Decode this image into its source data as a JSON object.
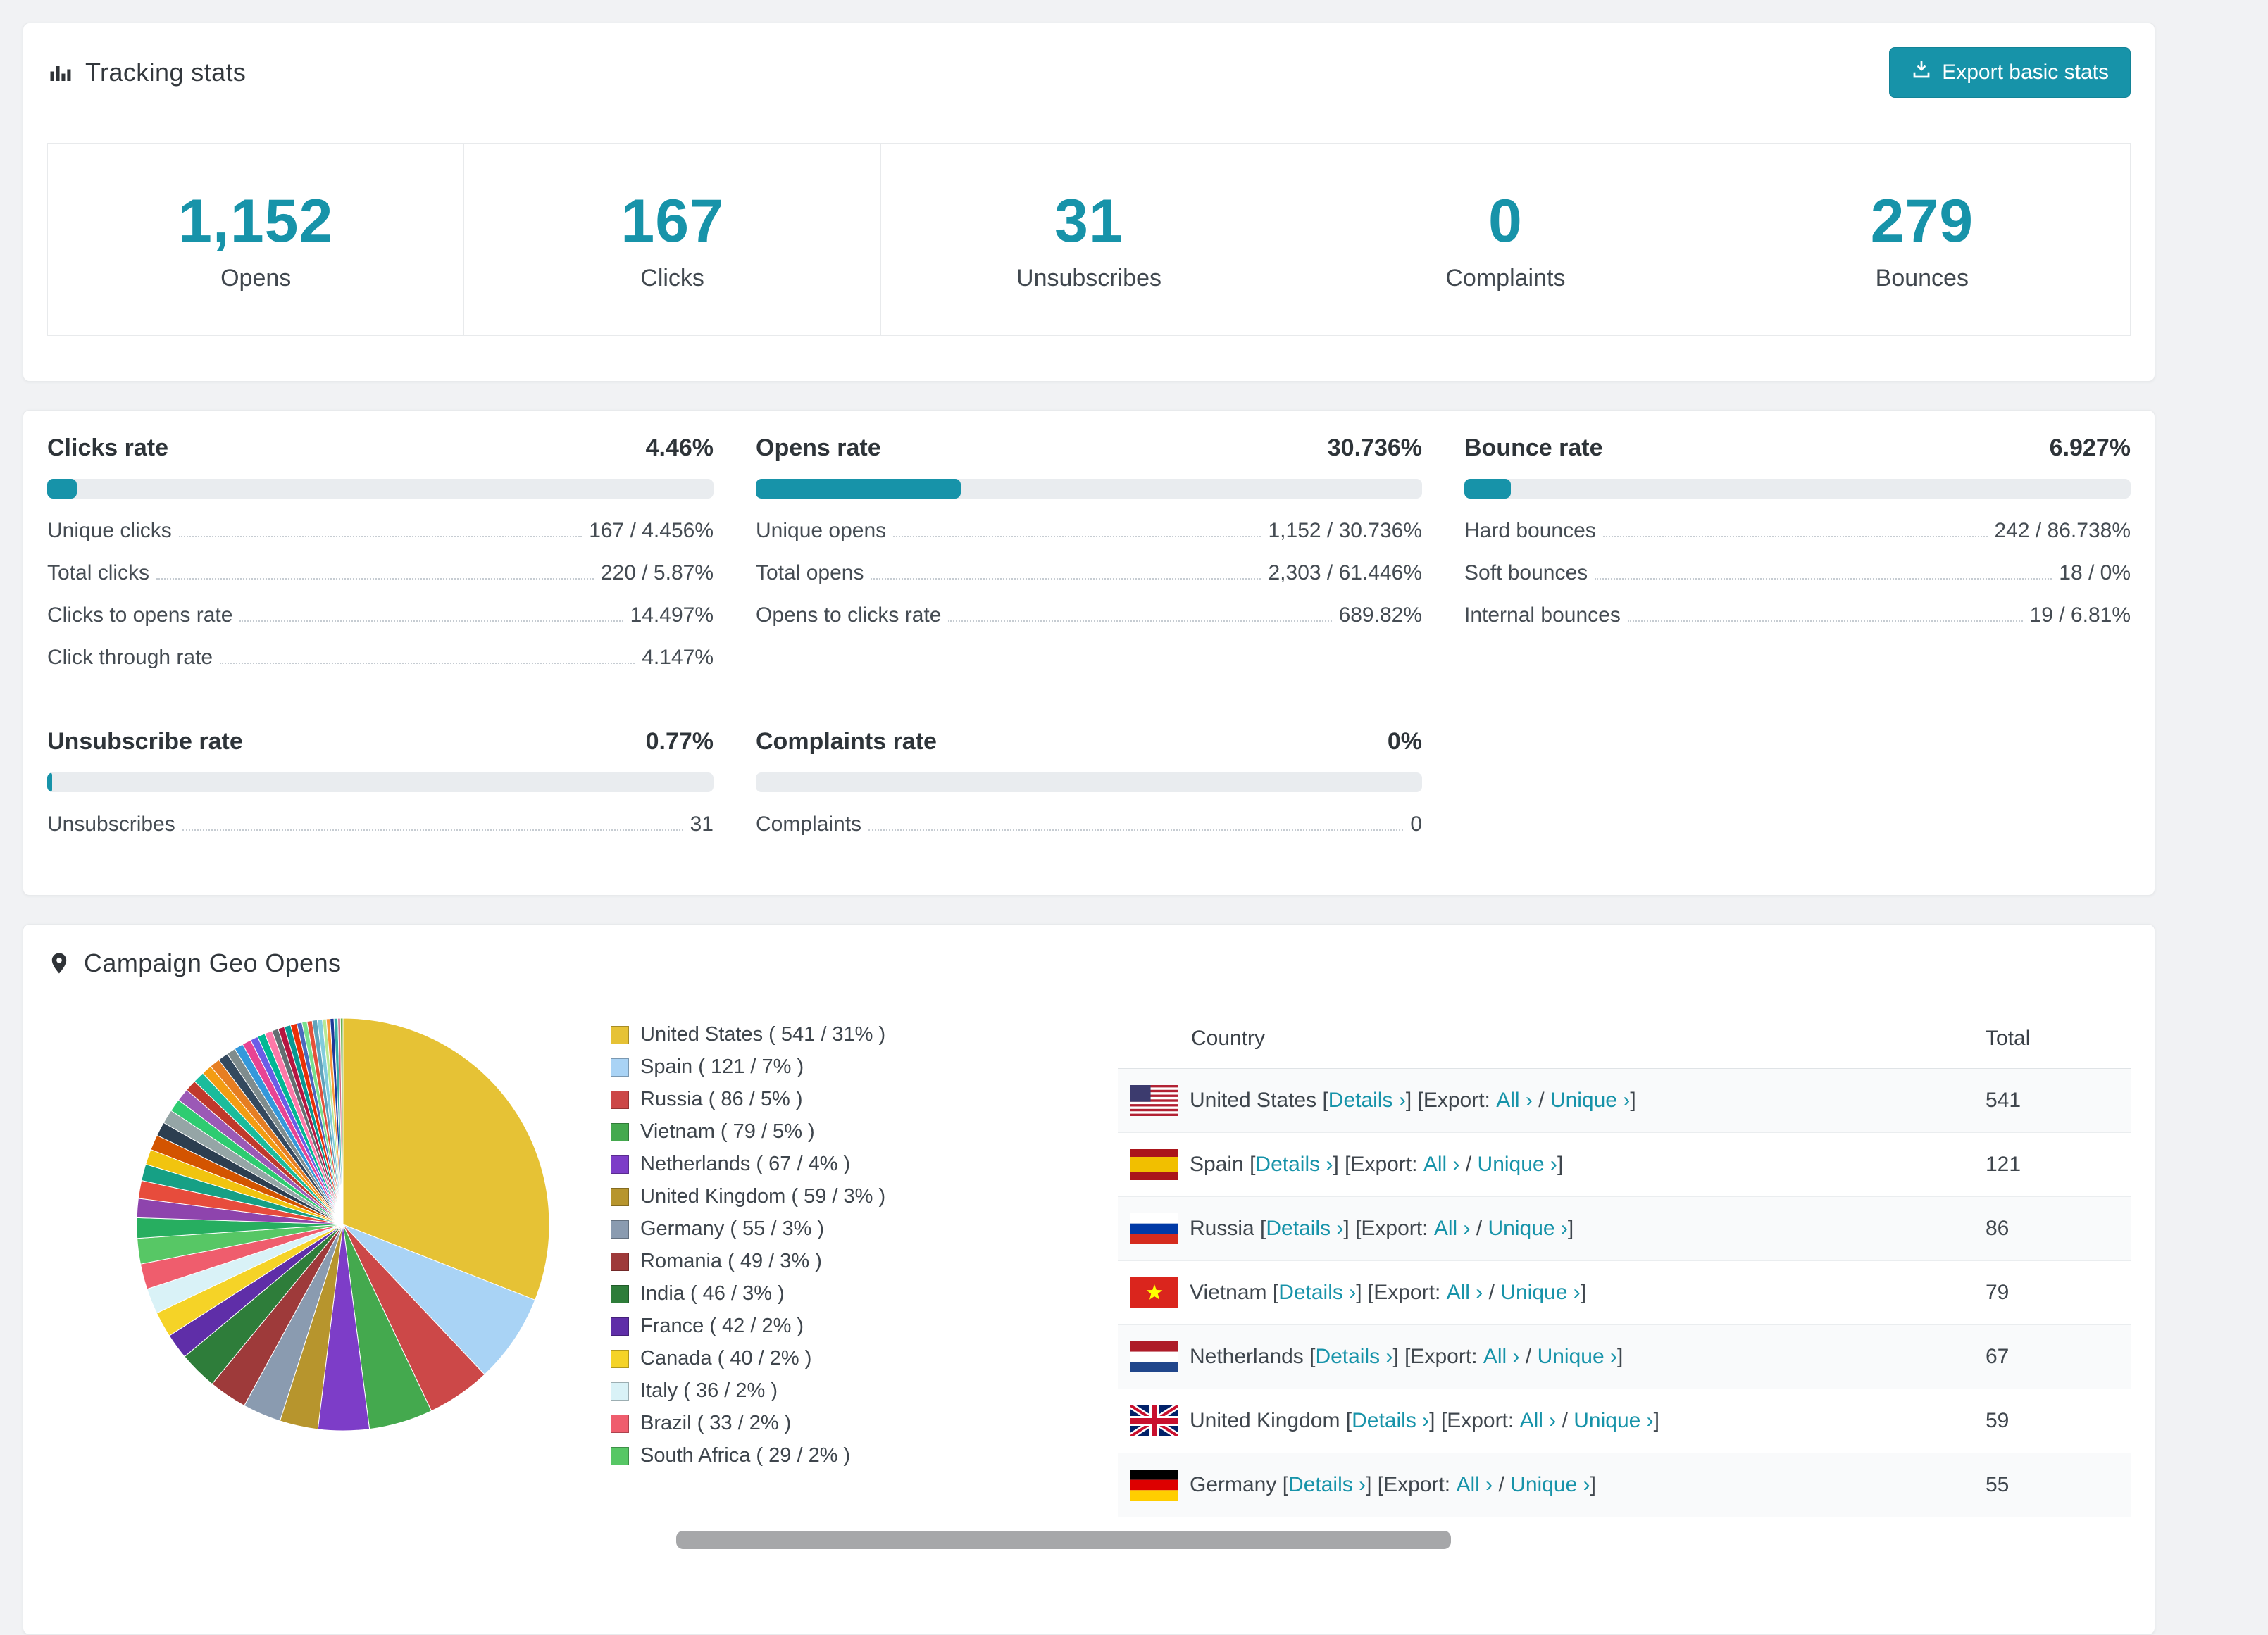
{
  "accent": "#1793a9",
  "tracking": {
    "icon": "bar-chart",
    "title": "Tracking stats",
    "export_button": {
      "icon": "download",
      "label": "Export basic stats"
    },
    "stats": [
      {
        "value": "1,152",
        "label": "Opens"
      },
      {
        "value": "167",
        "label": "Clicks"
      },
      {
        "value": "31",
        "label": "Unsubscribes"
      },
      {
        "value": "0",
        "label": "Complaints"
      },
      {
        "value": "279",
        "label": "Bounces"
      }
    ]
  },
  "rates": [
    {
      "title": "Clicks rate",
      "value": "4.46%",
      "percent": 4.46,
      "rows": [
        {
          "label": "Unique clicks",
          "value": "167 / 4.456%"
        },
        {
          "label": "Total clicks",
          "value": "220 / 5.87%"
        },
        {
          "label": "Clicks to opens rate",
          "value": "14.497%"
        },
        {
          "label": "Click through rate",
          "value": "4.147%"
        }
      ]
    },
    {
      "title": "Opens rate",
      "value": "30.736%",
      "percent": 30.736,
      "rows": [
        {
          "label": "Unique opens",
          "value": "1,152 / 30.736%"
        },
        {
          "label": "Total opens",
          "value": "2,303 / 61.446%"
        },
        {
          "label": "Opens to clicks rate",
          "value": "689.82%"
        }
      ]
    },
    {
      "title": "Bounce rate",
      "value": "6.927%",
      "percent": 6.927,
      "rows": [
        {
          "label": "Hard bounces",
          "value": "242 / 86.738%"
        },
        {
          "label": "Soft bounces",
          "value": "18 / 0%"
        },
        {
          "label": "Internal bounces",
          "value": "19 / 6.81%"
        }
      ]
    },
    {
      "title": "Unsubscribe rate",
      "value": "0.77%",
      "percent": 0.77,
      "rows": [
        {
          "label": "Unsubscribes",
          "value": "31"
        }
      ]
    },
    {
      "title": "Complaints rate",
      "value": "0%",
      "percent": 0,
      "rows": [
        {
          "label": "Complaints",
          "value": "0"
        }
      ]
    }
  ],
  "geo": {
    "icon": "map-pin",
    "title": "Campaign Geo Opens",
    "table": {
      "headers": [
        "Country",
        "Total"
      ],
      "links": {
        "details": "Details",
        "export": "Export:",
        "all": "All",
        "unique": "Unique",
        "arrow": "›"
      },
      "rows": [
        {
          "flag": "us",
          "name": "United States",
          "total": "541"
        },
        {
          "flag": "es",
          "name": "Spain",
          "total": "121"
        },
        {
          "flag": "ru",
          "name": "Russia",
          "total": "86"
        },
        {
          "flag": "vn",
          "name": "Vietnam",
          "total": "79"
        },
        {
          "flag": "nl",
          "name": "Netherlands",
          "total": "67"
        },
        {
          "flag": "gb",
          "name": "United Kingdom",
          "total": "59"
        },
        {
          "flag": "de",
          "name": "Germany",
          "total": "55"
        }
      ]
    }
  },
  "chart_data": {
    "type": "pie",
    "title": "Campaign Geo Opens",
    "legend_position": "right",
    "series": [
      {
        "name": "United States",
        "value": 541,
        "percent": 31,
        "color": "#e6c235"
      },
      {
        "name": "Spain",
        "value": 121,
        "percent": 7,
        "color": "#a9d3f5"
      },
      {
        "name": "Russia",
        "value": 86,
        "percent": 5,
        "color": "#cc4848"
      },
      {
        "name": "Vietnam",
        "value": 79,
        "percent": 5,
        "color": "#44a94e"
      },
      {
        "name": "Netherlands",
        "value": 67,
        "percent": 4,
        "color": "#7d3dc8"
      },
      {
        "name": "United Kingdom",
        "value": 59,
        "percent": 3,
        "color": "#b7952d"
      },
      {
        "name": "Germany",
        "value": 55,
        "percent": 3,
        "color": "#8a9bb0"
      },
      {
        "name": "Romania",
        "value": 49,
        "percent": 3,
        "color": "#9e3a3a"
      },
      {
        "name": "India",
        "value": 46,
        "percent": 3,
        "color": "#2e7d3a"
      },
      {
        "name": "France",
        "value": 42,
        "percent": 2,
        "color": "#5f2ea8"
      },
      {
        "name": "Canada",
        "value": 40,
        "percent": 2,
        "color": "#f5d327"
      },
      {
        "name": "Italy",
        "value": 36,
        "percent": 2,
        "color": "#d9f2f7"
      },
      {
        "name": "Brazil",
        "value": 33,
        "percent": 2,
        "color": "#ef5d6d"
      },
      {
        "name": "South Africa",
        "value": 29,
        "percent": 2,
        "color": "#57c765"
      }
    ],
    "others_segments": [
      {
        "percent": 1.6,
        "color": "#27ae60"
      },
      {
        "percent": 1.5,
        "color": "#8e44ad"
      },
      {
        "percent": 1.4,
        "color": "#e74c3c"
      },
      {
        "percent": 1.3,
        "color": "#16a085"
      },
      {
        "percent": 1.2,
        "color": "#f1c40f"
      },
      {
        "percent": 1.2,
        "color": "#d35400"
      },
      {
        "percent": 1.1,
        "color": "#2c3e50"
      },
      {
        "percent": 1.1,
        "color": "#95a5a6"
      },
      {
        "percent": 1.0,
        "color": "#2ecc71"
      },
      {
        "percent": 1.0,
        "color": "#9b59b6"
      },
      {
        "percent": 0.9,
        "color": "#c0392b"
      },
      {
        "percent": 0.9,
        "color": "#1abc9c"
      },
      {
        "percent": 0.8,
        "color": "#f39c12"
      },
      {
        "percent": 0.8,
        "color": "#e67e22"
      },
      {
        "percent": 0.8,
        "color": "#34495e"
      },
      {
        "percent": 0.7,
        "color": "#7f8c8d"
      },
      {
        "percent": 0.7,
        "color": "#3498db"
      },
      {
        "percent": 0.7,
        "color": "#e84393"
      },
      {
        "percent": 0.6,
        "color": "#6c5ce7"
      },
      {
        "percent": 0.6,
        "color": "#00b894"
      },
      {
        "percent": 0.6,
        "color": "#fd79a8"
      },
      {
        "percent": 0.5,
        "color": "#636e72"
      },
      {
        "percent": 0.5,
        "color": "#b71540"
      },
      {
        "percent": 0.5,
        "color": "#079992"
      },
      {
        "percent": 0.5,
        "color": "#eb2f06"
      },
      {
        "percent": 0.4,
        "color": "#4a69bd"
      },
      {
        "percent": 0.4,
        "color": "#78e08f"
      },
      {
        "percent": 0.4,
        "color": "#e55039"
      },
      {
        "percent": 0.4,
        "color": "#60a3bc"
      },
      {
        "percent": 0.4,
        "color": "#82ccdd"
      },
      {
        "percent": 0.3,
        "color": "#b8e994"
      },
      {
        "percent": 0.3,
        "color": "#fa983a"
      },
      {
        "percent": 0.3,
        "color": "#1e3799"
      },
      {
        "percent": 0.3,
        "color": "#38ada9"
      },
      {
        "percent": 0.2,
        "color": "#cf6a87"
      },
      {
        "percent": 0.2,
        "color": "#6ab04c"
      }
    ]
  }
}
